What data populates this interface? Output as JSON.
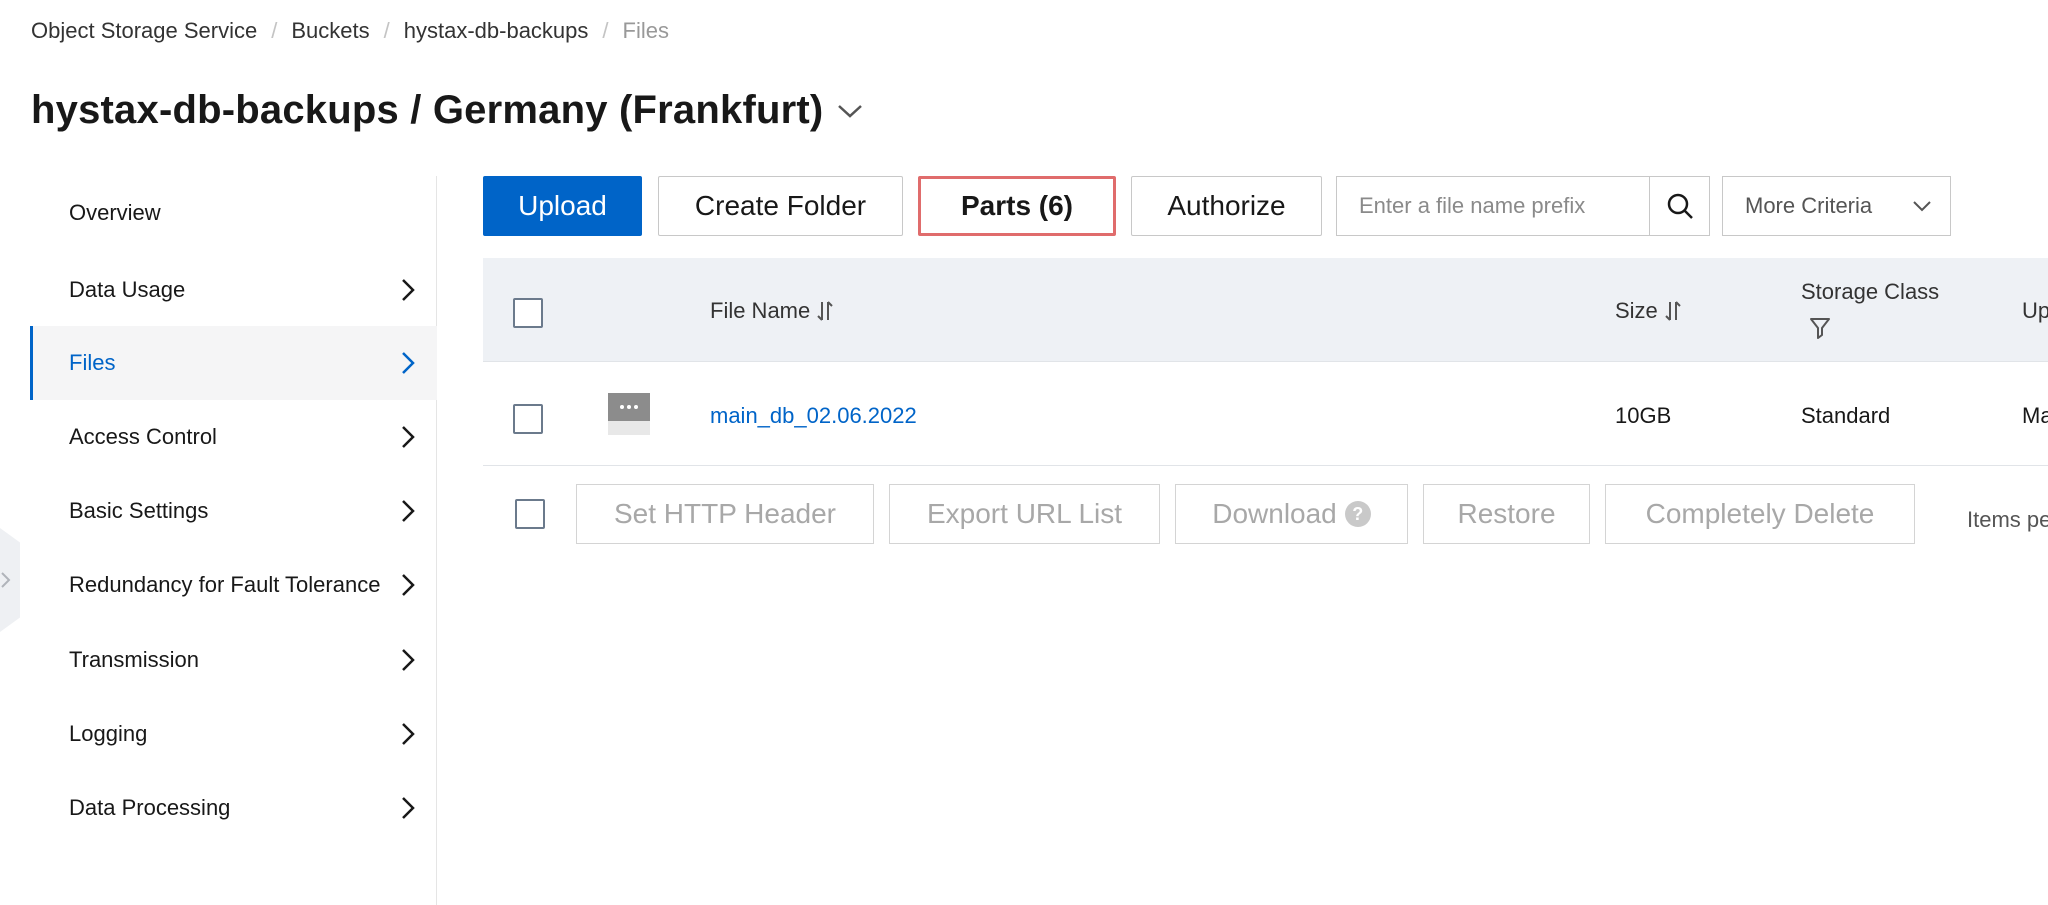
{
  "breadcrumb": {
    "items": [
      "Object Storage Service",
      "Buckets",
      "hystax-db-backups",
      "Files"
    ],
    "separator": "/"
  },
  "header": {
    "title": "hystax-db-backups / Germany (Frankfurt)"
  },
  "sidebar": {
    "items": [
      {
        "label": "Overview"
      },
      {
        "label": "Data Usage"
      },
      {
        "label": "Files"
      },
      {
        "label": "Access Control"
      },
      {
        "label": "Basic Settings"
      },
      {
        "label": "Redundancy for Fault Tolerance"
      },
      {
        "label": "Transmission"
      },
      {
        "label": "Logging"
      },
      {
        "label": "Data Processing"
      }
    ]
  },
  "toolbar": {
    "upload": "Upload",
    "create_folder": "Create Folder",
    "parts": "Parts (6)",
    "authorize": "Authorize",
    "search_placeholder": "Enter a file name prefix",
    "more_criteria": "More Criteria"
  },
  "table": {
    "columns": {
      "file_name": "File Name",
      "size": "Size",
      "storage_class": "Storage Class",
      "updated": "Up"
    },
    "rows": [
      {
        "file_name": "main_db_02.06.2022",
        "size": "10GB",
        "storage_class": "Standard",
        "updated": "Ma"
      }
    ]
  },
  "actions": {
    "set_http_header": "Set HTTP Header",
    "export_url_list": "Export URL List",
    "download": "Download",
    "download_help": "?",
    "restore": "Restore",
    "completely_delete": "Completely Delete",
    "items_per_page": "Items pe"
  },
  "colors": {
    "accent": "#0064c8",
    "parts_highlight": "#e06c6c",
    "table_header_bg": "#eef1f5"
  }
}
